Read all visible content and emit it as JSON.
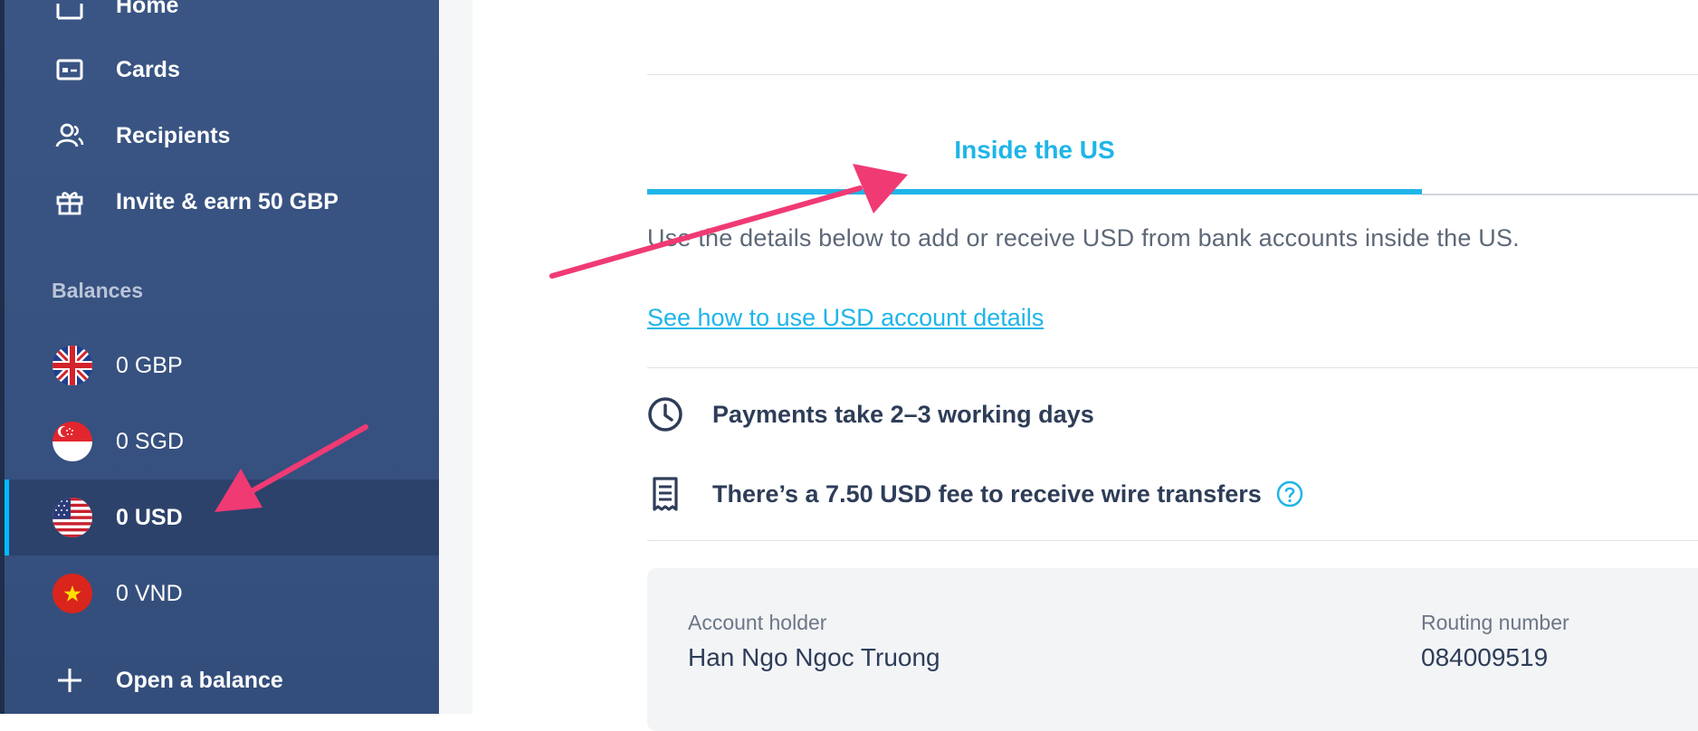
{
  "sidebar": {
    "nav": [
      {
        "label": "Home",
        "icon": "home-icon"
      },
      {
        "label": "Cards",
        "icon": "card-icon"
      },
      {
        "label": "Recipients",
        "icon": "recipients-icon"
      },
      {
        "label": "Invite & earn 50 GBP",
        "icon": "gift-icon"
      }
    ],
    "balances_heading": "Balances",
    "balances": [
      {
        "label": "0 GBP",
        "flag": "uk-flag-icon"
      },
      {
        "label": "0 SGD",
        "flag": "singapore-flag-icon"
      },
      {
        "label": "0 USD",
        "flag": "us-flag-icon",
        "active": true
      },
      {
        "label": "0 VND",
        "flag": "vietnam-flag-icon"
      }
    ],
    "open_balance_label": "Open a balance"
  },
  "main": {
    "tab_label": "Inside the US",
    "description": "Use the details below to add or receive USD from bank accounts inside the US.",
    "help_link": "See how to use USD account details",
    "info": [
      {
        "icon": "clock-icon",
        "text": "Payments take 2–3 working days"
      },
      {
        "icon": "receipt-icon",
        "text": "There’s a 7.50 USD fee to receive wire transfers"
      }
    ],
    "details": {
      "account_holder_label": "Account holder",
      "account_holder_value": "Han Ngo Ngoc Truong",
      "routing_number_label": "Routing number",
      "routing_number_value": "084009519"
    }
  },
  "colors": {
    "sidebar": "#3a5584",
    "accent": "#1fb5e8",
    "annotation_arrow": "#f03a74"
  }
}
